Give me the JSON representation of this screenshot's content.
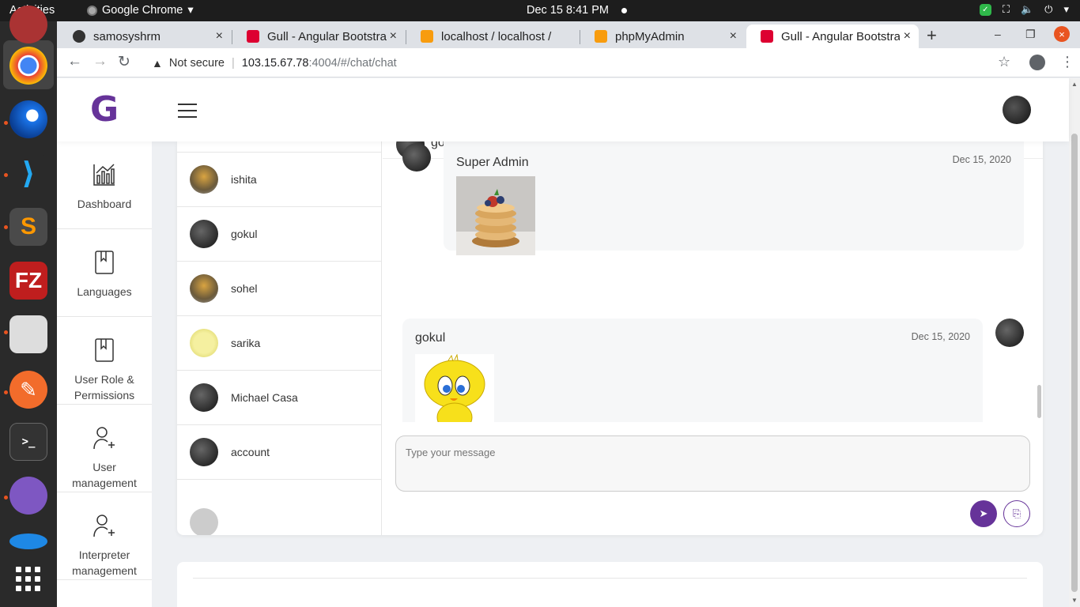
{
  "system_bar": {
    "activities": "Activities",
    "app_name": "Google Chrome",
    "clock": "Dec 15  8:41 PM"
  },
  "browser": {
    "tabs": [
      {
        "title": "samosyshrm",
        "active": false
      },
      {
        "title": "Gull - Angular Bootstra",
        "active": false
      },
      {
        "title": "localhost / localhost /",
        "active": false
      },
      {
        "title": "phpMyAdmin",
        "active": false
      },
      {
        "title": "Gull - Angular Bootstra",
        "active": true
      }
    ],
    "security_label": "Not secure",
    "url_host": "103.15.67.78",
    "url_path": ":4004/#/chat/chat"
  },
  "app": {
    "logo": "G",
    "sidebar": [
      {
        "label": "Dashboard",
        "icon": "chart-icon"
      },
      {
        "label": "Languages",
        "icon": "book-icon"
      },
      {
        "label": "User Role & Permissions",
        "icon": "book-icon"
      },
      {
        "label": "User management",
        "icon": "add-user-icon"
      },
      {
        "label": "Interpreter management",
        "icon": "add-user-icon"
      }
    ],
    "contacts": [
      {
        "name": "ishita"
      },
      {
        "name": "gokul"
      },
      {
        "name": "sohel"
      },
      {
        "name": "sarika"
      },
      {
        "name": "Michael Casa"
      },
      {
        "name": "account"
      }
    ],
    "chat": {
      "header_name": "gokul",
      "messages": [
        {
          "sender": "Super Admin",
          "date": "Dec 15, 2020",
          "image": "pancakes-image"
        },
        {
          "sender": "gokul",
          "date": "Dec 15, 2020",
          "image": "tweety-image"
        }
      ],
      "input_placeholder": "Type your message"
    }
  },
  "colors": {
    "brand": "#663399",
    "accent_close": "#e95420"
  }
}
